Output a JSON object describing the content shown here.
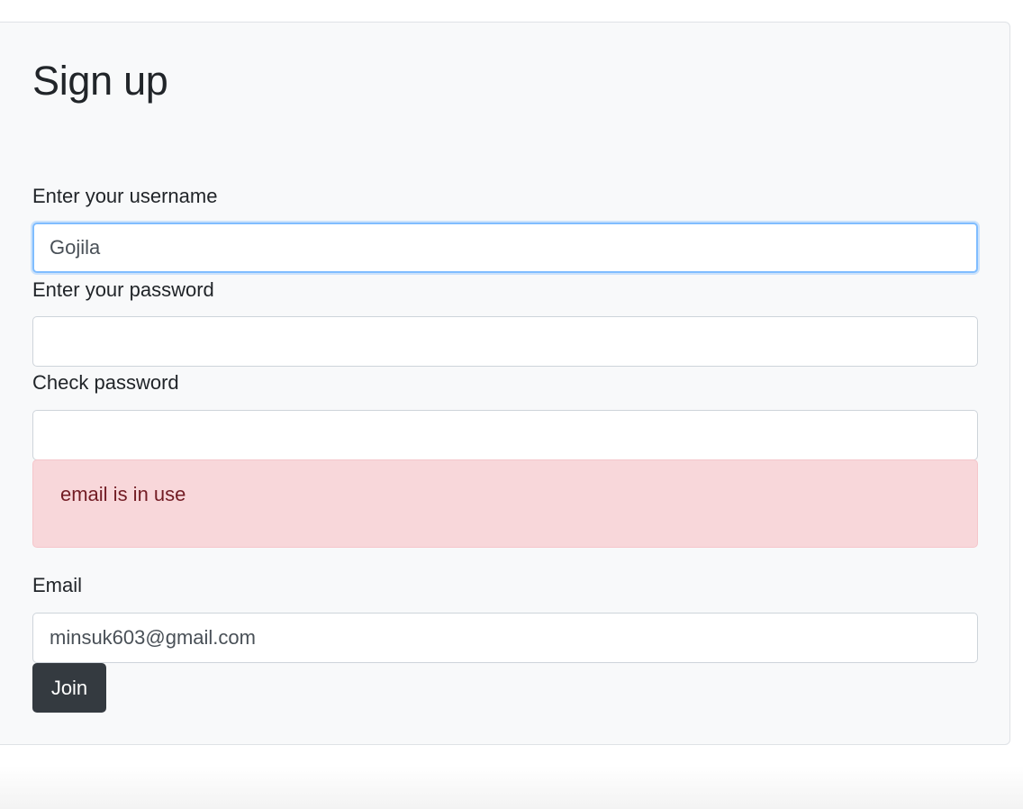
{
  "form": {
    "title": "Sign up",
    "username_label": "Enter your username",
    "username_value": "Gojila",
    "password_label": "Enter your password",
    "password_value": "",
    "check_password_label": "Check password",
    "check_password_value": "",
    "alert_text": "email is in use",
    "email_label": "Email",
    "email_value": "minsuk603@gmail.com",
    "join_label": "Join"
  },
  "colors": {
    "card_background": "#f8f9fa",
    "alert_background": "#f8d7da",
    "alert_text": "#721c24",
    "button_background": "#343a40",
    "focus_border": "#80bdff"
  }
}
